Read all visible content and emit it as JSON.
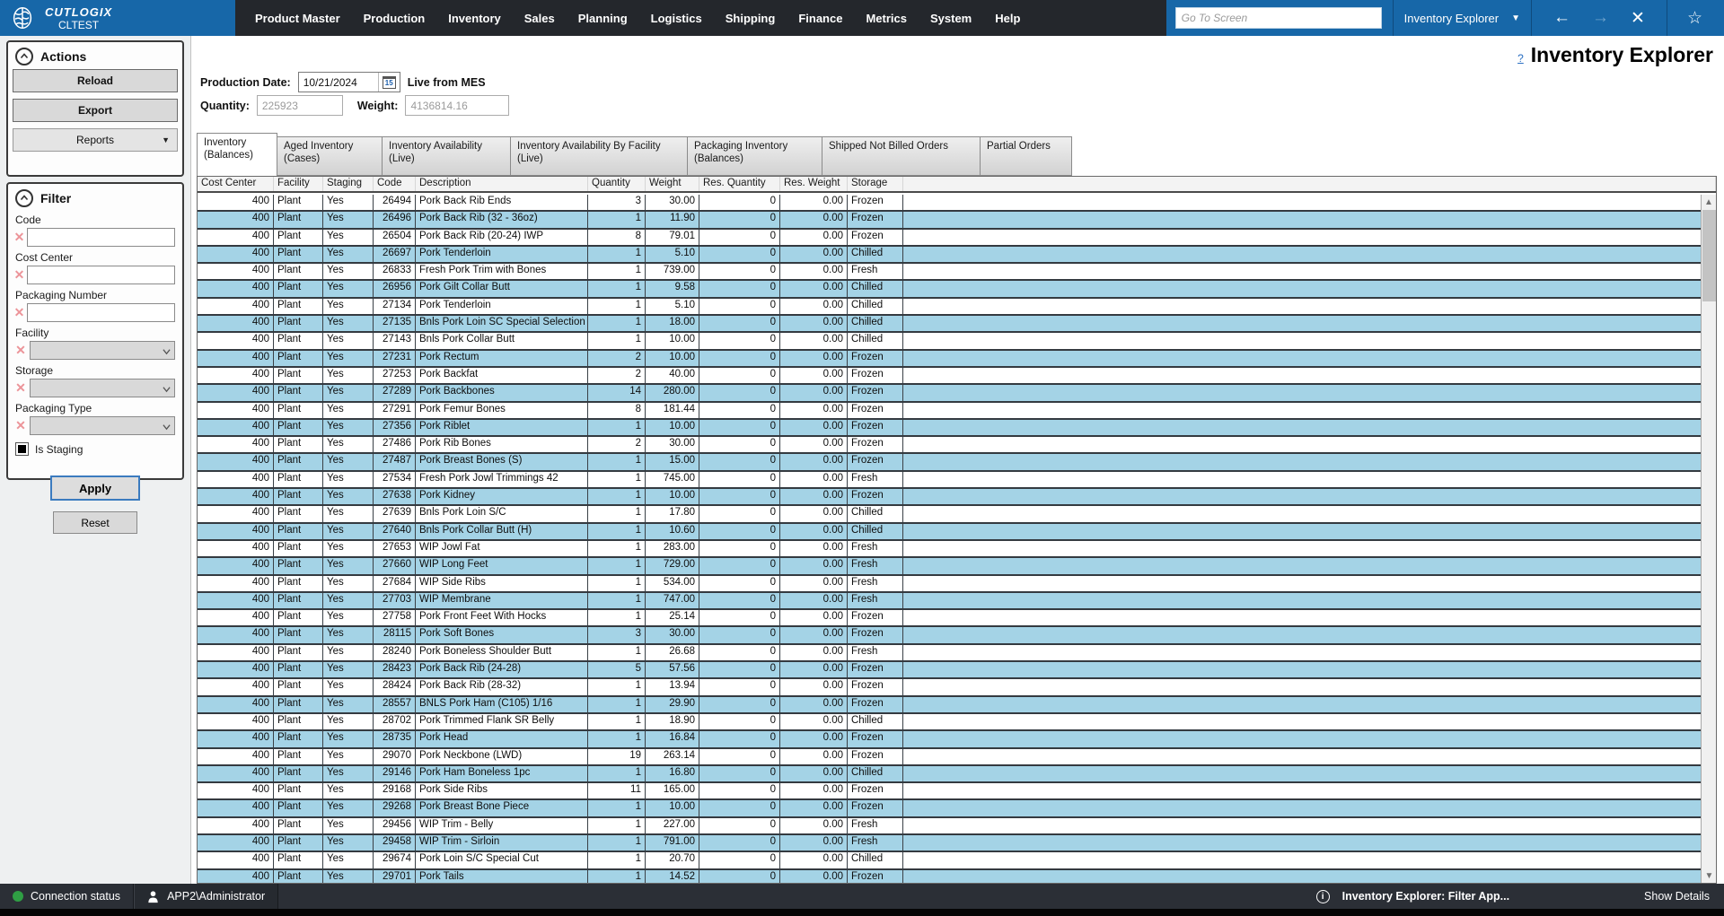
{
  "topbar": {
    "brand_name": "CUTLOGIX",
    "brand_env": "CLTEST",
    "menus": [
      "Product Master",
      "Production",
      "Inventory",
      "Sales",
      "Planning",
      "Logistics",
      "Shipping",
      "Finance",
      "Metrics",
      "System",
      "Help"
    ],
    "goto_placeholder": "Go To Screen",
    "screen_selector": "Inventory Explorer"
  },
  "page": {
    "help_link": "?",
    "title": "Inventory Explorer"
  },
  "actions_panel": {
    "title": "Actions",
    "reload": "Reload",
    "export": "Export",
    "reports": "Reports"
  },
  "filter_panel": {
    "title": "Filter",
    "fields": [
      {
        "label": "Code",
        "type": "text"
      },
      {
        "label": "Cost Center",
        "type": "text"
      },
      {
        "label": "Packaging Number",
        "type": "text"
      },
      {
        "label": "Facility",
        "type": "select"
      },
      {
        "label": "Storage",
        "type": "select"
      },
      {
        "label": "Packaging Type",
        "type": "select"
      }
    ],
    "checkbox_label": "Is Staging",
    "checkbox_checked": true,
    "apply": "Apply",
    "reset": "Reset"
  },
  "controls": {
    "production_date_label": "Production Date:",
    "production_date": "10/21/2024",
    "calendar_day": "15",
    "live_label": "Live from MES",
    "quantity_label": "Quantity:",
    "quantity": "225923",
    "weight_label": "Weight:",
    "weight": "4136814.16"
  },
  "tabs": [
    {
      "line1": "Inventory",
      "line2": "(Balances)",
      "active": true
    },
    {
      "line1": "Aged Inventory",
      "line2": "(Cases)",
      "active": false
    },
    {
      "line1": "Inventory Availability",
      "line2": "(Live)",
      "active": false
    },
    {
      "line1": "Inventory Availability By Facility",
      "line2": "(Live)",
      "active": false
    },
    {
      "line1": "Packaging Inventory",
      "line2": "(Balances)",
      "active": false
    },
    {
      "line1": "Shipped Not Billed Orders",
      "line2": "",
      "active": false
    },
    {
      "line1": "Partial Orders",
      "line2": "",
      "active": false
    }
  ],
  "table": {
    "columns": [
      "Cost Center",
      "Facility",
      "Staging",
      "Code",
      "Description",
      "Quantity",
      "Weight",
      "Res. Quantity",
      "Res. Weight",
      "Storage"
    ],
    "rows": [
      [
        "400",
        "Plant",
        "Yes",
        "26494",
        "Pork Back Rib Ends",
        "3",
        "30.00",
        "0",
        "0.00",
        "Frozen"
      ],
      [
        "400",
        "Plant",
        "Yes",
        "26496",
        "Pork Back Rib (32 - 36oz)",
        "1",
        "11.90",
        "0",
        "0.00",
        "Frozen"
      ],
      [
        "400",
        "Plant",
        "Yes",
        "26504",
        "Pork Back Rib (20-24) IWP",
        "8",
        "79.01",
        "0",
        "0.00",
        "Frozen"
      ],
      [
        "400",
        "Plant",
        "Yes",
        "26697",
        "Pork Tenderloin",
        "1",
        "5.10",
        "0",
        "0.00",
        "Chilled"
      ],
      [
        "400",
        "Plant",
        "Yes",
        "26833",
        "Fresh Pork Trim with Bones",
        "1",
        "739.00",
        "0",
        "0.00",
        "Fresh"
      ],
      [
        "400",
        "Plant",
        "Yes",
        "26956",
        "Pork Gilt Collar Butt",
        "1",
        "9.58",
        "0",
        "0.00",
        "Chilled"
      ],
      [
        "400",
        "Plant",
        "Yes",
        "27134",
        "Pork Tenderloin",
        "1",
        "5.10",
        "0",
        "0.00",
        "Chilled"
      ],
      [
        "400",
        "Plant",
        "Yes",
        "27135",
        "Bnls Pork Loin SC Special Selection",
        "1",
        "18.00",
        "0",
        "0.00",
        "Chilled"
      ],
      [
        "400",
        "Plant",
        "Yes",
        "27143",
        "Bnls Pork Collar Butt",
        "1",
        "10.00",
        "0",
        "0.00",
        "Chilled"
      ],
      [
        "400",
        "Plant",
        "Yes",
        "27231",
        "Pork Rectum",
        "2",
        "10.00",
        "0",
        "0.00",
        "Frozen"
      ],
      [
        "400",
        "Plant",
        "Yes",
        "27253",
        "Pork Backfat",
        "2",
        "40.00",
        "0",
        "0.00",
        "Frozen"
      ],
      [
        "400",
        "Plant",
        "Yes",
        "27289",
        "Pork Backbones",
        "14",
        "280.00",
        "0",
        "0.00",
        "Frozen"
      ],
      [
        "400",
        "Plant",
        "Yes",
        "27291",
        "Pork Femur Bones",
        "8",
        "181.44",
        "0",
        "0.00",
        "Frozen"
      ],
      [
        "400",
        "Plant",
        "Yes",
        "27356",
        "Pork Riblet",
        "1",
        "10.00",
        "0",
        "0.00",
        "Frozen"
      ],
      [
        "400",
        "Plant",
        "Yes",
        "27486",
        "Pork Rib Bones",
        "2",
        "30.00",
        "0",
        "0.00",
        "Frozen"
      ],
      [
        "400",
        "Plant",
        "Yes",
        "27487",
        "Pork Breast Bones (S)",
        "1",
        "15.00",
        "0",
        "0.00",
        "Frozen"
      ],
      [
        "400",
        "Plant",
        "Yes",
        "27534",
        "Fresh Pork Jowl Trimmings 42",
        "1",
        "745.00",
        "0",
        "0.00",
        "Fresh"
      ],
      [
        "400",
        "Plant",
        "Yes",
        "27638",
        "Pork Kidney",
        "1",
        "10.00",
        "0",
        "0.00",
        "Frozen"
      ],
      [
        "400",
        "Plant",
        "Yes",
        "27639",
        "Bnls Pork Loin S/C",
        "1",
        "17.80",
        "0",
        "0.00",
        "Chilled"
      ],
      [
        "400",
        "Plant",
        "Yes",
        "27640",
        "Bnls Pork Collar Butt (H)",
        "1",
        "10.60",
        "0",
        "0.00",
        "Chilled"
      ],
      [
        "400",
        "Plant",
        "Yes",
        "27653",
        "WIP Jowl Fat",
        "1",
        "283.00",
        "0",
        "0.00",
        "Fresh"
      ],
      [
        "400",
        "Plant",
        "Yes",
        "27660",
        "WIP Long Feet",
        "1",
        "729.00",
        "0",
        "0.00",
        "Fresh"
      ],
      [
        "400",
        "Plant",
        "Yes",
        "27684",
        "WIP Side Ribs",
        "1",
        "534.00",
        "0",
        "0.00",
        "Fresh"
      ],
      [
        "400",
        "Plant",
        "Yes",
        "27703",
        "WIP Membrane",
        "1",
        "747.00",
        "0",
        "0.00",
        "Fresh"
      ],
      [
        "400",
        "Plant",
        "Yes",
        "27758",
        "Pork Front Feet With Hocks",
        "1",
        "25.14",
        "0",
        "0.00",
        "Frozen"
      ],
      [
        "400",
        "Plant",
        "Yes",
        "28115",
        "Pork Soft Bones",
        "3",
        "30.00",
        "0",
        "0.00",
        "Frozen"
      ],
      [
        "400",
        "Plant",
        "Yes",
        "28240",
        "Pork Boneless Shoulder Butt",
        "1",
        "26.68",
        "0",
        "0.00",
        "Fresh"
      ],
      [
        "400",
        "Plant",
        "Yes",
        "28423",
        "Pork Back Rib (24-28)",
        "5",
        "57.56",
        "0",
        "0.00",
        "Frozen"
      ],
      [
        "400",
        "Plant",
        "Yes",
        "28424",
        "Pork Back Rib (28-32)",
        "1",
        "13.94",
        "0",
        "0.00",
        "Frozen"
      ],
      [
        "400",
        "Plant",
        "Yes",
        "28557",
        "BNLS Pork Ham (C105) 1/16",
        "1",
        "29.90",
        "0",
        "0.00",
        "Frozen"
      ],
      [
        "400",
        "Plant",
        "Yes",
        "28702",
        "Pork Trimmed Flank SR Belly",
        "1",
        "18.90",
        "0",
        "0.00",
        "Chilled"
      ],
      [
        "400",
        "Plant",
        "Yes",
        "28735",
        "Pork Head",
        "1",
        "16.84",
        "0",
        "0.00",
        "Frozen"
      ],
      [
        "400",
        "Plant",
        "Yes",
        "29070",
        "Pork Neckbone (LWD)",
        "19",
        "263.14",
        "0",
        "0.00",
        "Frozen"
      ],
      [
        "400",
        "Plant",
        "Yes",
        "29146",
        "Pork Ham Boneless 1pc",
        "1",
        "16.80",
        "0",
        "0.00",
        "Chilled"
      ],
      [
        "400",
        "Plant",
        "Yes",
        "29168",
        "Pork Side Ribs",
        "11",
        "165.00",
        "0",
        "0.00",
        "Frozen"
      ],
      [
        "400",
        "Plant",
        "Yes",
        "29268",
        "Pork Breast Bone Piece",
        "1",
        "10.00",
        "0",
        "0.00",
        "Frozen"
      ],
      [
        "400",
        "Plant",
        "Yes",
        "29456",
        "WIP Trim - Belly",
        "1",
        "227.00",
        "0",
        "0.00",
        "Fresh"
      ],
      [
        "400",
        "Plant",
        "Yes",
        "29458",
        "WIP Trim - Sirloin",
        "1",
        "791.00",
        "0",
        "0.00",
        "Fresh"
      ],
      [
        "400",
        "Plant",
        "Yes",
        "29674",
        "Pork Loin S/C Special Cut",
        "1",
        "20.70",
        "0",
        "0.00",
        "Chilled"
      ],
      [
        "400",
        "Plant",
        "Yes",
        "29701",
        "Pork Tails",
        "1",
        "14.52",
        "0",
        "0.00",
        "Frozen"
      ]
    ]
  },
  "statusbar": {
    "connection": "Connection status",
    "user": "APP2\\Administrator",
    "message": "Inventory Explorer: Filter App...",
    "show_details": "Show Details"
  },
  "colors": {
    "accent_blue": "#1767a8",
    "row_alt_blue": "#a4d3e6",
    "status_green": "#2f9e44",
    "clear_x_red": "#ec9499"
  }
}
